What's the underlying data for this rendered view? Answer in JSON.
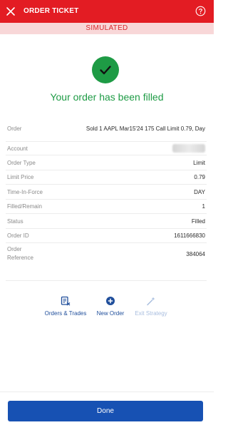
{
  "header": {
    "title": "ORDER TICKET",
    "color": "#e31c23"
  },
  "banner": {
    "text": "SIMULATED"
  },
  "status": {
    "message": "Your order has been filled",
    "icon": "check-icon",
    "color": "#1e9b45"
  },
  "details": [
    {
      "label": "Order",
      "value": "Sold 1 AAPL Mar15'24 175 Call Limit 0.79, Day"
    },
    {
      "label": "Account",
      "value": "",
      "redacted": true
    },
    {
      "label": "Order Type",
      "value": "Limit"
    },
    {
      "label": "Limit Price",
      "value": "0.79"
    },
    {
      "label": "Time-In-Force",
      "value": "DAY"
    },
    {
      "label": "Filled/Remain",
      "value": "1"
    },
    {
      "label": "Status",
      "value": "Filled"
    },
    {
      "label": "Order ID",
      "value": "1611666830"
    },
    {
      "label": "Order Reference",
      "value": "384064"
    }
  ],
  "actions": {
    "orders_trades": "Orders & Trades",
    "new_order": "New Order",
    "exit_strategy": "Exit Strategy"
  },
  "footer": {
    "done_label": "Done"
  }
}
